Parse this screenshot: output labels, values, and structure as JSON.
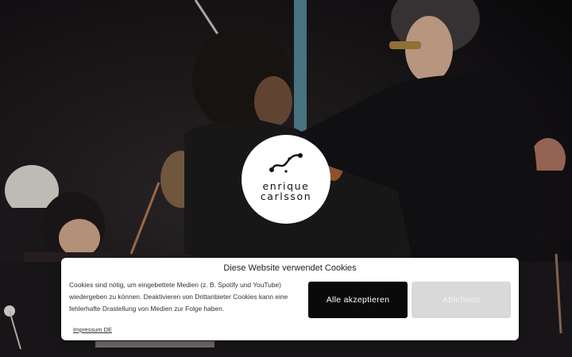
{
  "brand": {
    "logo_line1": "enrique",
    "logo_line2": "carlsson"
  },
  "cookie_banner": {
    "title": "Diese Website verwendet Cookies",
    "body": "Cookies sind nötig, um eingebettete Medien (z. B. Spotify und YouTube) wiedergeben zu können. Deaktivieren von Drittanbieter Cookies kann eine fehlerhafte Drastellung von Medien zur Folge haben.",
    "accept_label": "Alle akzeptieren",
    "decline_label": "Ablehnen",
    "impressum_label": "Impressum DE"
  },
  "colors": {
    "accept_button": "#0a0a0a",
    "decline_button": "#d9d9d9",
    "banner_background": "#ffffff"
  },
  "icons": {
    "logo_mark": "violin-f-hole-icon"
  }
}
